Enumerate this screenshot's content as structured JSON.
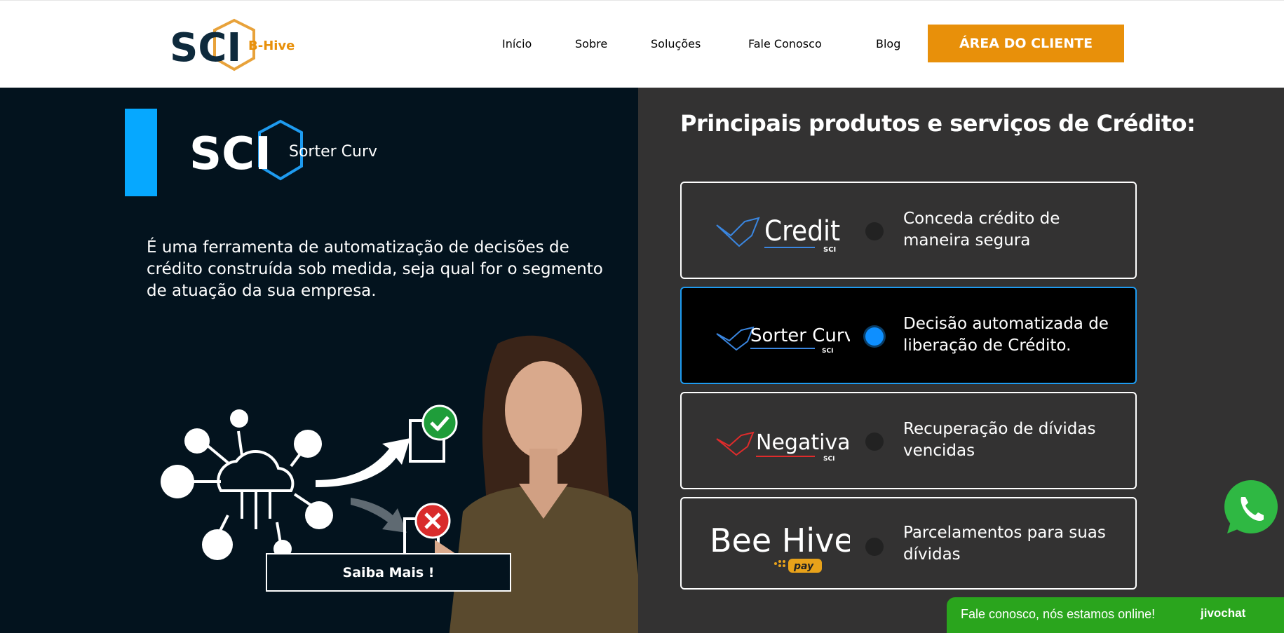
{
  "header": {
    "logo_text": "SCI",
    "logo_sub": "B-Hive",
    "nav": [
      {
        "label": "Início"
      },
      {
        "label": "Sobre"
      },
      {
        "label": "Soluções"
      },
      {
        "label": "Fale Conosco"
      },
      {
        "label": "Blog"
      }
    ],
    "cta_label": "ÁREA DO CLIENTE"
  },
  "hero": {
    "product_logo_text": "SCI",
    "product_logo_sub": "Sorter Curve",
    "description": "É uma ferramenta de automatização de decisões de crédito construída sob medida, seja qual for o segmento de atuação da sua empresa.",
    "button_label": "Saiba Mais !"
  },
  "products": {
    "title": "Principais produtos e serviços de Crédito:",
    "items": [
      {
        "brand": "Credit",
        "brand_sub": "SCI",
        "text": "Conceda crédito de maneira segura",
        "active": false
      },
      {
        "brand": "Sorter Curve",
        "brand_sub": "SCI",
        "text": "Decisão automatizada de liberação de Crédito.",
        "active": true
      },
      {
        "brand": "Negativa",
        "brand_sub": "SCI",
        "text": "Recuperação de dívidas vencidas",
        "active": false
      },
      {
        "brand": "Bee Hive",
        "brand_sub": "pay",
        "text": "Parcelamentos para suas dívidas",
        "active": false
      }
    ]
  },
  "chat": {
    "text": "Fale conosco, nós estamos online!",
    "brand": "jivochat"
  },
  "colors": {
    "accent": "#e8900a",
    "hero_bg": "#03131e",
    "panel_bg": "#333232",
    "blue": "#06a8ff",
    "whatsapp": "#2aa51d"
  },
  "icons": [
    "whatsapp-icon",
    "cloud-network-icon",
    "check-document-icon",
    "x-document-icon"
  ]
}
